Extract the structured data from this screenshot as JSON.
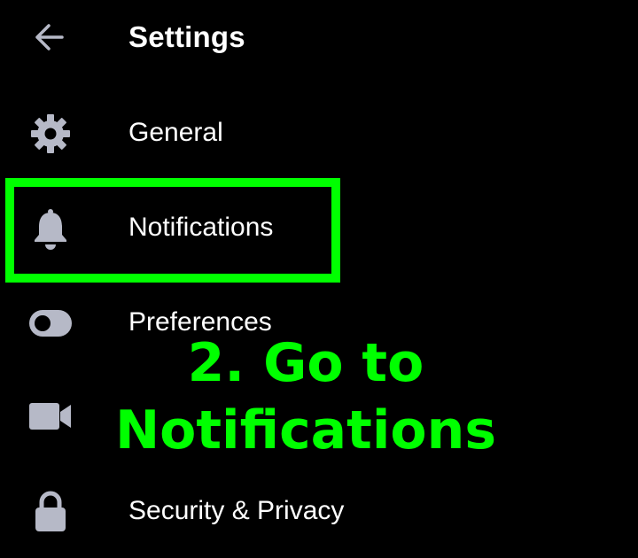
{
  "header": {
    "title": "Settings",
    "back_icon": "arrow-left-icon"
  },
  "menu": {
    "items": [
      {
        "label": "General",
        "icon": "gear-icon"
      },
      {
        "label": "Notifications",
        "icon": "bell-icon"
      },
      {
        "label": "Preferences",
        "icon": "toggle-icon"
      },
      {
        "label": "",
        "icon": "video-camera-icon"
      },
      {
        "label": "Security & Privacy",
        "icon": "lock-icon"
      }
    ]
  },
  "annotation": {
    "line1": "2. Go to",
    "line2": "Notifications",
    "color": "#00ff00"
  },
  "colors": {
    "background": "#000000",
    "text": "#ffffff",
    "icon": "#b6b9c7",
    "highlight": "#00ff00"
  }
}
